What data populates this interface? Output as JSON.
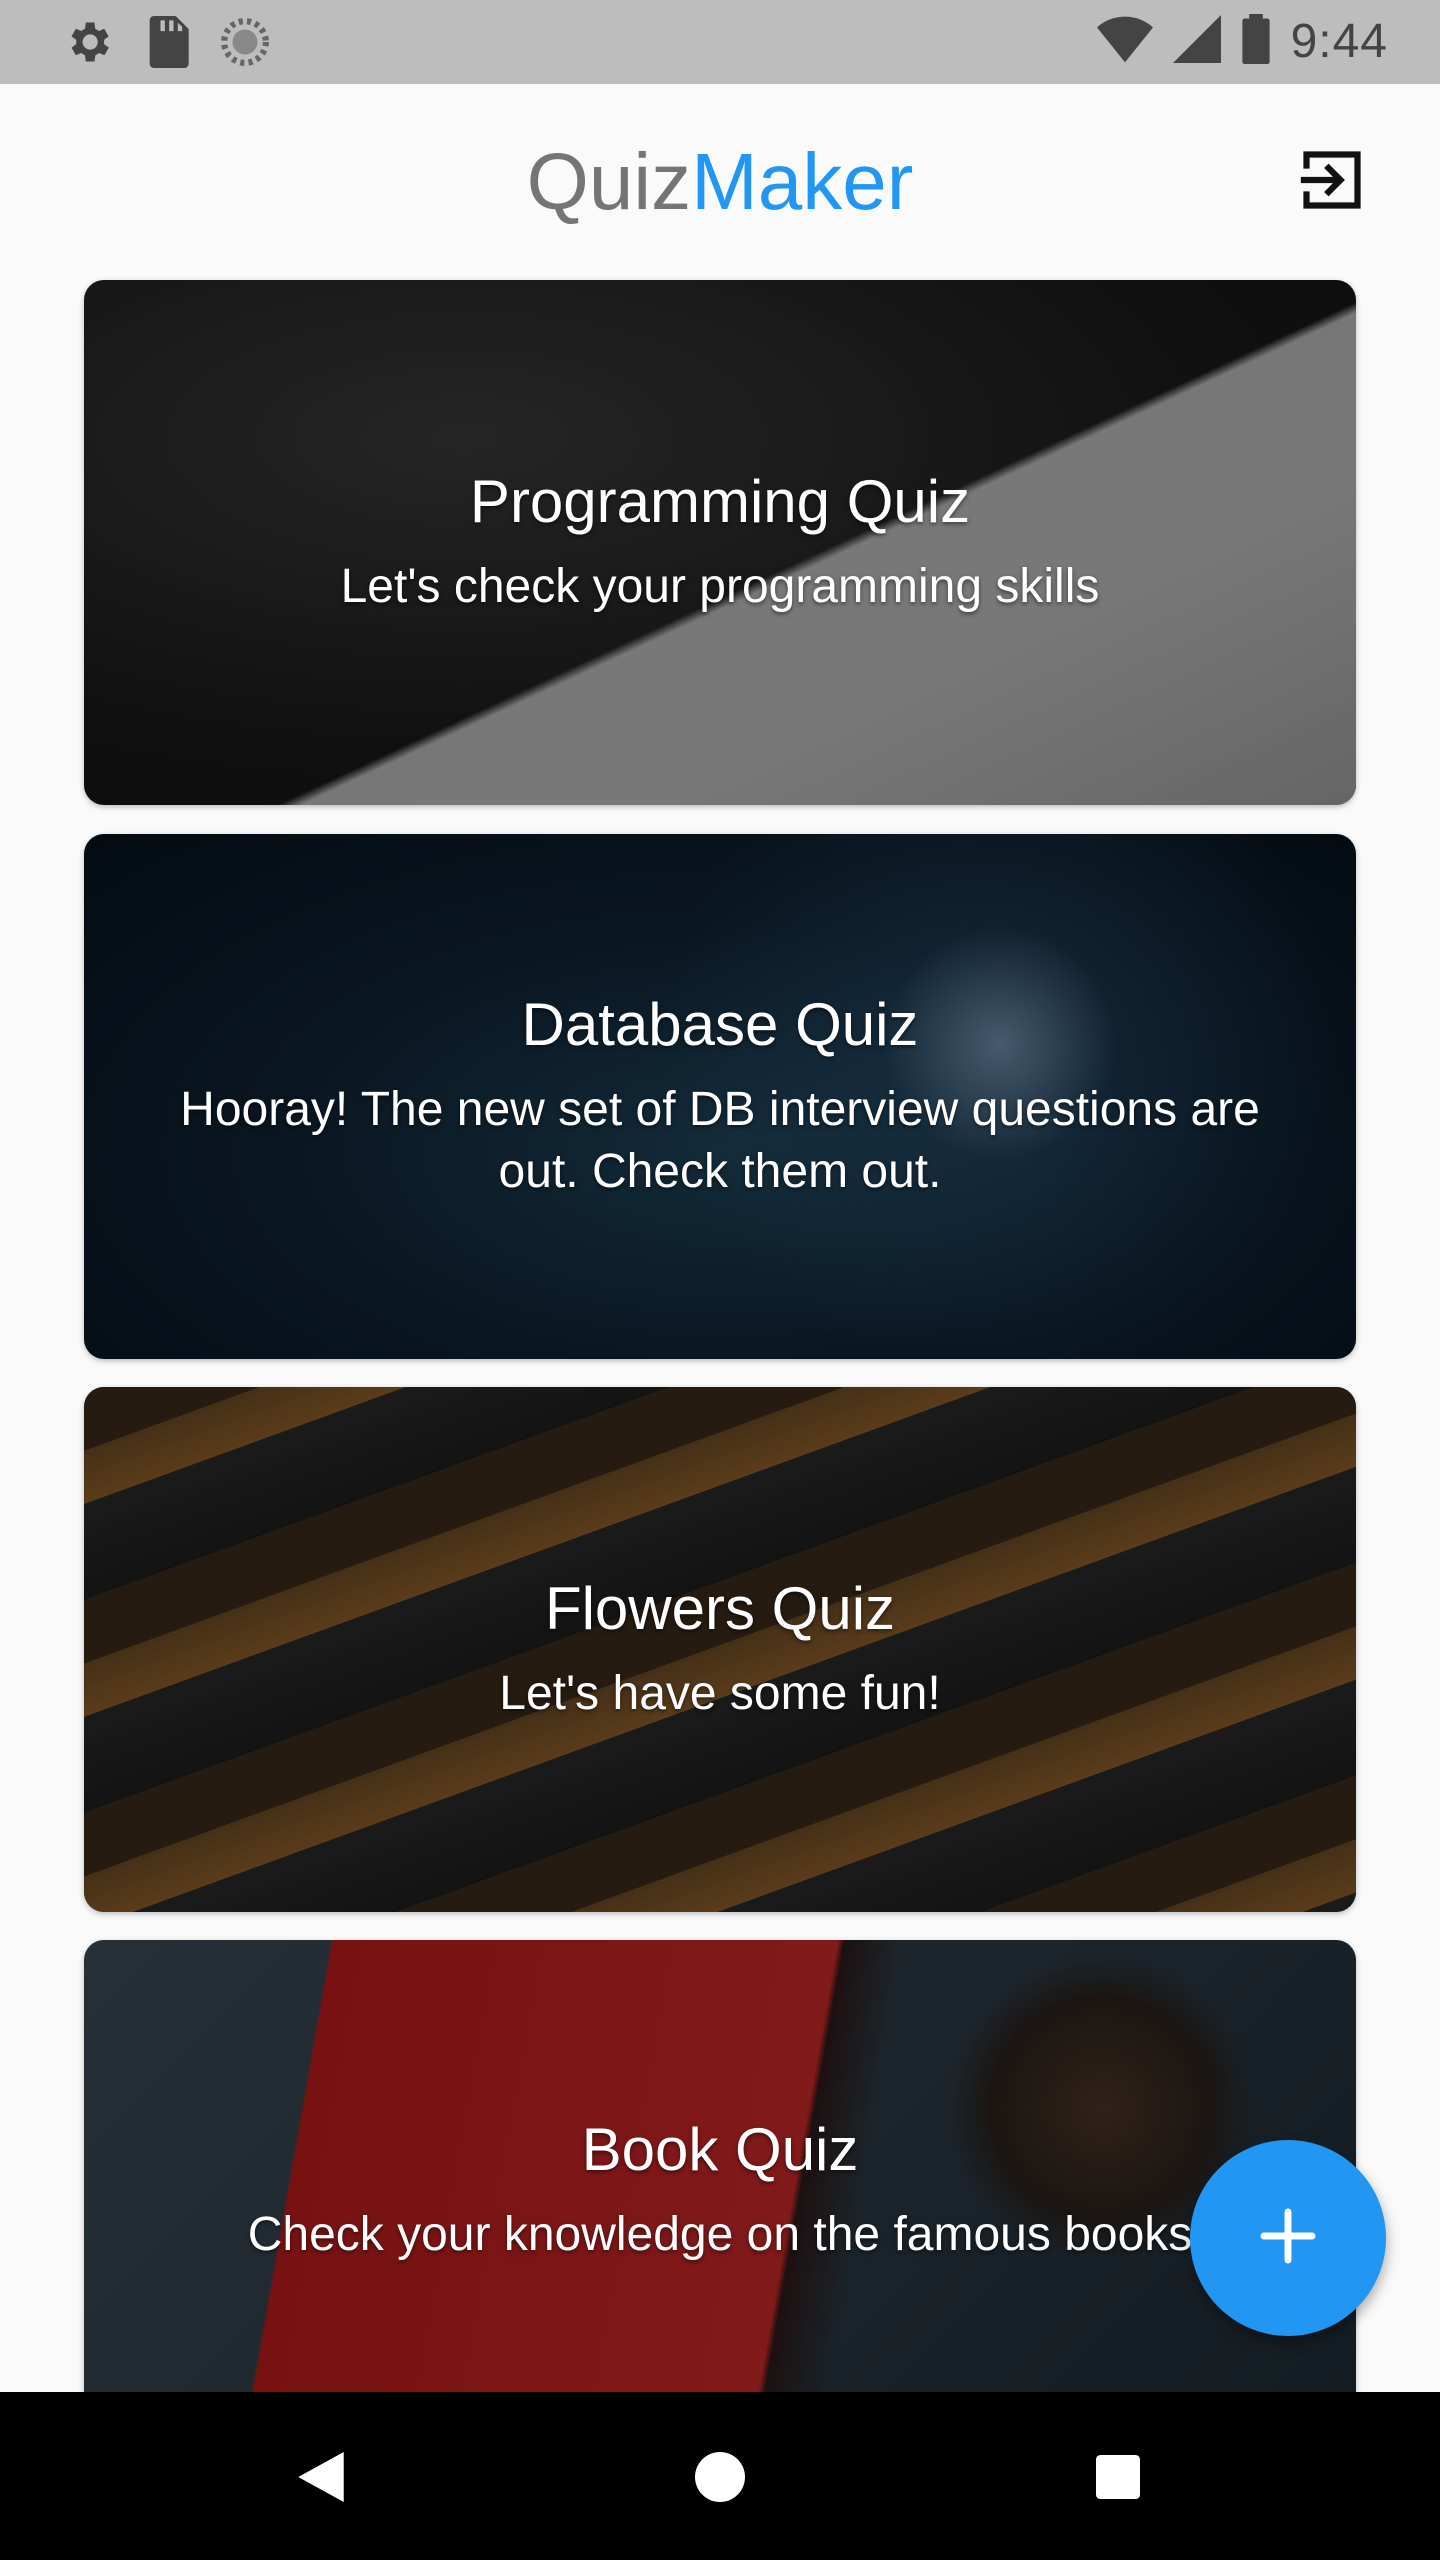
{
  "status_bar": {
    "time": "9:44",
    "left_icons": [
      "settings-icon",
      "sd-card-icon",
      "loading-circle-icon"
    ],
    "right_icons": [
      "wifi-icon",
      "signal-icon",
      "battery-icon"
    ]
  },
  "app_bar": {
    "title_part_1": "Quiz",
    "title_part_2": "Maker",
    "action_icon": "logout-icon"
  },
  "quizzes": [
    {
      "title": "Programming Quiz",
      "description": "Let's check your programming skills"
    },
    {
      "title": "Database Quiz",
      "description": "Hooray! The new set of DB interview questions are out. Check them out."
    },
    {
      "title": "Flowers Quiz",
      "description": "Let's have some fun!"
    },
    {
      "title": "Book Quiz",
      "description": "Check your knowledge on the famous books"
    }
  ],
  "fab": {
    "icon": "plus-icon"
  },
  "nav_bar": {
    "icons": [
      "back-icon",
      "home-icon",
      "recent-apps-icon"
    ]
  },
  "colors": {
    "accent": "#2196f3",
    "title_gray": "#757575",
    "status_bar": "#bdbdbd",
    "nav_bar": "#000000"
  }
}
